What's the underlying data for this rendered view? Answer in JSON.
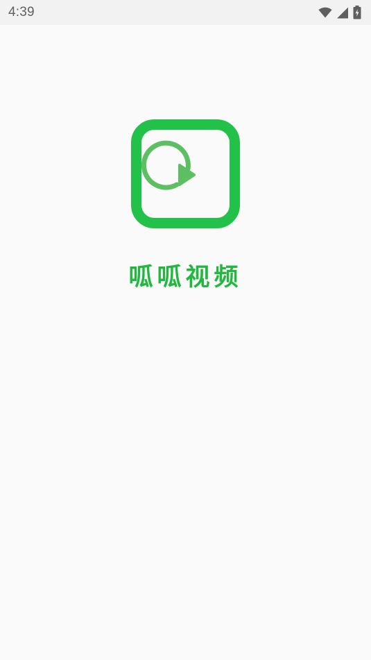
{
  "status_bar": {
    "time": "4:39",
    "icons": [
      "wifi-icon",
      "cellular-signal-icon",
      "battery-charging-icon"
    ]
  },
  "splash": {
    "logo_icon": "play-circle-icon",
    "app_name": "呱呱视频"
  },
  "colors": {
    "brand_green": "#22c24a",
    "logo_inner_green": "#5cbf62",
    "background": "#fafafa",
    "status_bar_bg": "#f2f2f2",
    "status_text": "#5f5f5f"
  }
}
